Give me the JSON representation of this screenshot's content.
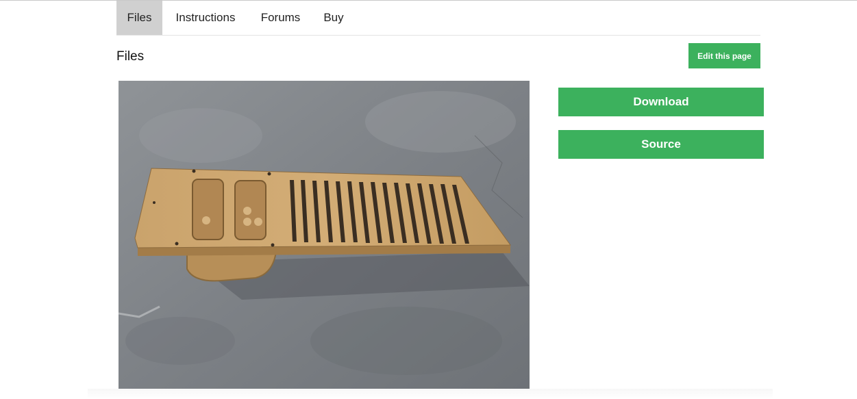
{
  "tabs": {
    "files": "Files",
    "instructions": "Instructions",
    "forums": "Forums",
    "buy": "Buy"
  },
  "page": {
    "title": "Files",
    "edit_label": "Edit this page"
  },
  "actions": {
    "download_label": "Download",
    "source_label": "Source"
  },
  "colors": {
    "accent_green": "#3cb15d",
    "active_tab": "#d0d0d0"
  }
}
